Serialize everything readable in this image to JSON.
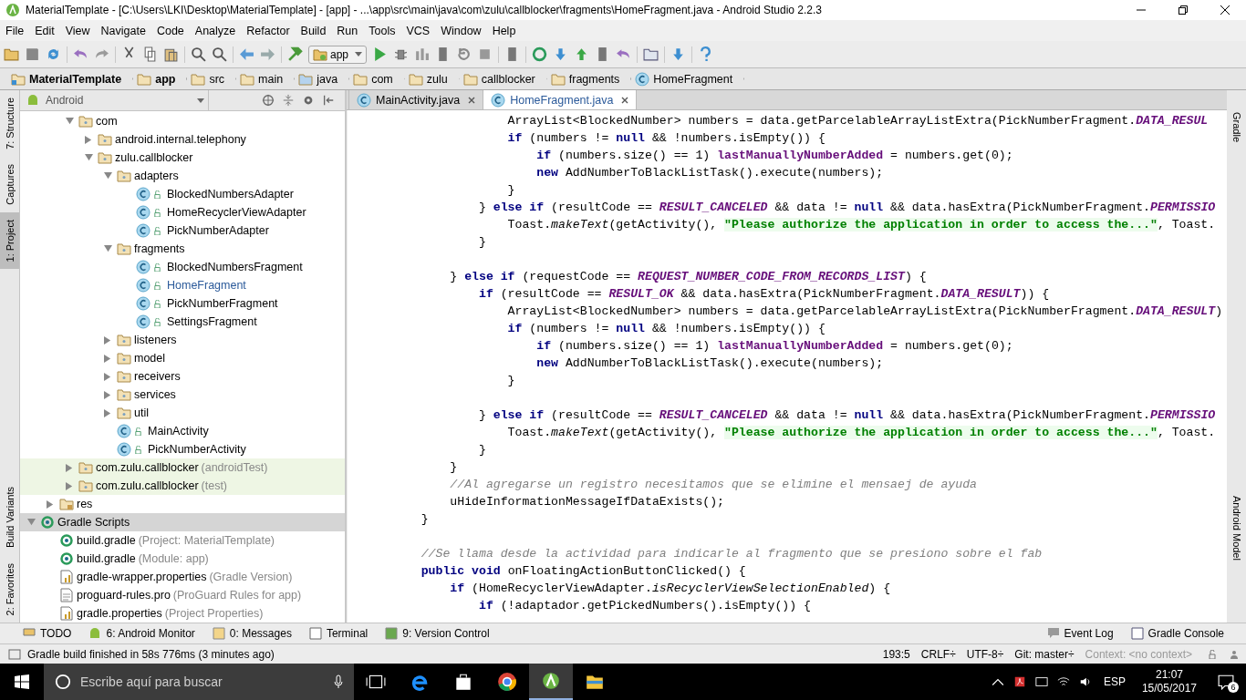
{
  "window": {
    "title": "MaterialTemplate - [C:\\Users\\LKI\\Desktop\\MaterialTemplate] - [app] - ...\\app\\src\\main\\java\\com\\zulu\\callblocker\\fragments\\HomeFragment.java - Android Studio 2.2.3"
  },
  "menu": [
    "File",
    "Edit",
    "View",
    "Navigate",
    "Code",
    "Analyze",
    "Refactor",
    "Build",
    "Run",
    "Tools",
    "VCS",
    "Window",
    "Help"
  ],
  "toolbar": {
    "run_config": "app"
  },
  "breadcrumbs": [
    {
      "kind": "project",
      "label": "MaterialTemplate"
    },
    {
      "kind": "module",
      "label": "app"
    },
    {
      "kind": "folder",
      "label": "src"
    },
    {
      "kind": "folder",
      "label": "main"
    },
    {
      "kind": "source",
      "label": "java"
    },
    {
      "kind": "folder",
      "label": "com"
    },
    {
      "kind": "folder",
      "label": "zulu"
    },
    {
      "kind": "folder",
      "label": "callblocker"
    },
    {
      "kind": "folder",
      "label": "fragments"
    },
    {
      "kind": "class",
      "label": "HomeFragment"
    }
  ],
  "left_stripe": [
    {
      "label": "7: Structure",
      "selected": false
    },
    {
      "label": "Captures",
      "selected": false
    },
    {
      "label": "1: Project",
      "selected": true
    },
    {
      "label": "Build Variants",
      "selected": false
    },
    {
      "label": "2: Favorites",
      "selected": false
    }
  ],
  "right_stripe": [
    {
      "label": "Gradle"
    },
    {
      "label": "Android Model"
    }
  ],
  "project_panel": {
    "view": "Android",
    "tree": [
      {
        "children": [
          {
            "children": [
              {
                "kind": "package",
                "label": "com",
                "expanded": true,
                "selected": false,
                "children": [
                  {
                    "kind": "package",
                    "label": "android.internal.telephony",
                    "expanded": false,
                    "selected": false
                  },
                  {
                    "kind": "package",
                    "label": "zulu.callblocker",
                    "expanded": true,
                    "selected": false,
                    "children": [
                      {
                        "kind": "package",
                        "label": "adapters",
                        "expanded": true,
                        "selected": false,
                        "children": [
                          {
                            "kind": "class",
                            "label": "BlockedNumbersAdapter",
                            "selected": false,
                            "open": false
                          },
                          {
                            "kind": "class",
                            "label": "HomeRecyclerViewAdapter",
                            "selected": false,
                            "open": false
                          },
                          {
                            "kind": "class",
                            "label": "PickNumberAdapter",
                            "selected": false,
                            "open": false
                          }
                        ]
                      },
                      {
                        "kind": "package",
                        "label": "fragments",
                        "expanded": true,
                        "selected": false,
                        "children": [
                          {
                            "kind": "class",
                            "label": "BlockedNumbersFragment",
                            "selected": false,
                            "open": false
                          },
                          {
                            "kind": "class",
                            "label": "HomeFragment",
                            "selected": false,
                            "open": true
                          },
                          {
                            "kind": "class",
                            "label": "PickNumberFragment",
                            "selected": false,
                            "open": false
                          },
                          {
                            "kind": "class",
                            "label": "SettingsFragment",
                            "selected": false,
                            "open": false
                          }
                        ]
                      },
                      {
                        "kind": "package",
                        "label": "listeners",
                        "expanded": false,
                        "selected": false
                      },
                      {
                        "kind": "package",
                        "label": "model",
                        "expanded": false,
                        "selected": false
                      },
                      {
                        "kind": "package",
                        "label": "receivers",
                        "expanded": false,
                        "selected": false
                      },
                      {
                        "kind": "package",
                        "label": "services",
                        "expanded": false,
                        "selected": false
                      },
                      {
                        "kind": "package",
                        "label": "util",
                        "expanded": false,
                        "selected": false
                      },
                      {
                        "kind": "class",
                        "label": "MainActivity",
                        "selected": false,
                        "open": false
                      },
                      {
                        "kind": "class",
                        "label": "PickNumberActivity",
                        "selected": false,
                        "open": false
                      }
                    ]
                  }
                ]
              },
              {
                "kind": "test-package",
                "label": "com.zulu.callblocker",
                "note": "(androidTest)",
                "expanded": false,
                "selected": false
              },
              {
                "kind": "test-package",
                "label": "com.zulu.callblocker",
                "note": "(test)",
                "expanded": false,
                "selected": false
              }
            ]
          },
          {
            "kind": "res",
            "label": "res",
            "expanded": false,
            "selected": false
          }
        ]
      },
      {
        "kind": "gradle-scripts",
        "label": "Gradle Scripts",
        "expanded": true,
        "selected": true,
        "children": [
          {
            "kind": "gradle",
            "label": "build.gradle",
            "note": "(Project: MaterialTemplate)",
            "selected": false
          },
          {
            "kind": "gradle",
            "label": "build.gradle",
            "note": "(Module: app)",
            "selected": false
          },
          {
            "kind": "properties",
            "label": "gradle-wrapper.properties",
            "note": "(Gradle Version)",
            "selected": false
          },
          {
            "kind": "file",
            "label": "proguard-rules.pro",
            "note": "(ProGuard Rules for app)",
            "selected": false
          },
          {
            "kind": "properties",
            "label": "gradle.properties",
            "note": "(Project Properties)",
            "selected": false
          }
        ]
      }
    ]
  },
  "editor_tabs": [
    {
      "label": "MainActivity.java",
      "selected": false
    },
    {
      "label": "HomeFragment.java",
      "selected": true
    }
  ],
  "code": [
    {
      "gap_before": false,
      "tokens": [
        {
          "kind": "plain",
          "text": "                ArrayList<BlockedNumber> numbers = data.getParcelableArrayListExtra(PickNumberFragment."
        },
        {
          "kind": "const",
          "text": "DATA_RESUL"
        }
      ]
    },
    {
      "gap_before": false,
      "tokens": [
        {
          "kind": "kw",
          "text": "                if"
        },
        {
          "kind": "plain",
          "text": " (numbers != "
        },
        {
          "kind": "kw",
          "text": "null"
        },
        {
          "kind": "plain",
          "text": " && !numbers.isEmpty()) {"
        }
      ]
    },
    {
      "gap_before": false,
      "tokens": [
        {
          "kind": "kw",
          "text": "                    if"
        },
        {
          "kind": "plain",
          "text": " (numbers.size() == 1) "
        },
        {
          "kind": "field",
          "text": "lastManuallyNumberAdded"
        },
        {
          "kind": "plain",
          "text": " = numbers.get(0);"
        }
      ]
    },
    {
      "gap_before": false,
      "tokens": [
        {
          "kind": "kw",
          "text": "                    new"
        },
        {
          "kind": "plain",
          "text": " AddNumberToBlackListTask().execute(numbers);"
        }
      ]
    },
    {
      "gap_before": false,
      "tokens": [
        {
          "kind": "plain",
          "text": "                }"
        }
      ]
    },
    {
      "gap_before": false,
      "tokens": [
        {
          "kind": "plain",
          "text": "            } "
        },
        {
          "kind": "kw",
          "text": "else if"
        },
        {
          "kind": "plain",
          "text": " (resultCode == "
        },
        {
          "kind": "const",
          "text": "RESULT_CANCELED"
        },
        {
          "kind": "plain",
          "text": " && data != "
        },
        {
          "kind": "kw",
          "text": "null"
        },
        {
          "kind": "plain",
          "text": " && data.hasExtra(PickNumberFragment."
        },
        {
          "kind": "const",
          "text": "PERMISSIO"
        }
      ]
    },
    {
      "gap_before": false,
      "tokens": [
        {
          "kind": "plain",
          "text": "                Toast."
        },
        {
          "kind": "static",
          "text": "makeText"
        },
        {
          "kind": "plain",
          "text": "(getActivity(), "
        },
        {
          "kind": "string",
          "text": "\"Please authorize the application in order to access the...\""
        },
        {
          "kind": "plain",
          "text": ", Toast."
        }
      ]
    },
    {
      "gap_before": false,
      "tokens": [
        {
          "kind": "plain",
          "text": "            }"
        }
      ]
    },
    {
      "gap_before": true,
      "tokens": [
        {
          "kind": "plain",
          "text": "        } "
        },
        {
          "kind": "kw",
          "text": "else if"
        },
        {
          "kind": "plain",
          "text": " (requestCode == "
        },
        {
          "kind": "const",
          "text": "REQUEST_NUMBER_CODE_FROM_RECORDS_LIST"
        },
        {
          "kind": "plain",
          "text": ") {"
        }
      ]
    },
    {
      "gap_before": false,
      "tokens": [
        {
          "kind": "kw",
          "text": "            if"
        },
        {
          "kind": "plain",
          "text": " (resultCode == "
        },
        {
          "kind": "const",
          "text": "RESULT_OK"
        },
        {
          "kind": "plain",
          "text": " && data.hasExtra(PickNumberFragment."
        },
        {
          "kind": "const",
          "text": "DATA_RESULT"
        },
        {
          "kind": "plain",
          "text": ")) {"
        }
      ]
    },
    {
      "gap_before": false,
      "tokens": [
        {
          "kind": "plain",
          "text": "                ArrayList<BlockedNumber> numbers = data.getParcelableArrayListExtra(PickNumberFragment."
        },
        {
          "kind": "const",
          "text": "DATA_RESULT"
        },
        {
          "kind": "plain",
          "text": ")"
        }
      ]
    },
    {
      "gap_before": false,
      "tokens": [
        {
          "kind": "kw",
          "text": "                if"
        },
        {
          "kind": "plain",
          "text": " (numbers != "
        },
        {
          "kind": "kw",
          "text": "null"
        },
        {
          "kind": "plain",
          "text": " && !numbers.isEmpty()) {"
        }
      ]
    },
    {
      "gap_before": false,
      "tokens": [
        {
          "kind": "kw",
          "text": "                    if"
        },
        {
          "kind": "plain",
          "text": " (numbers.size() == 1) "
        },
        {
          "kind": "field",
          "text": "lastManuallyNumberAdded"
        },
        {
          "kind": "plain",
          "text": " = numbers.get(0);"
        }
      ]
    },
    {
      "gap_before": false,
      "tokens": [
        {
          "kind": "kw",
          "text": "                    new"
        },
        {
          "kind": "plain",
          "text": " AddNumberToBlackListTask().execute(numbers);"
        }
      ]
    },
    {
      "gap_before": false,
      "tokens": [
        {
          "kind": "plain",
          "text": "                }"
        }
      ]
    },
    {
      "gap_before": true,
      "tokens": [
        {
          "kind": "plain",
          "text": "            } "
        },
        {
          "kind": "kw",
          "text": "else if"
        },
        {
          "kind": "plain",
          "text": " (resultCode == "
        },
        {
          "kind": "const",
          "text": "RESULT_CANCELED"
        },
        {
          "kind": "plain",
          "text": " && data != "
        },
        {
          "kind": "kw",
          "text": "null"
        },
        {
          "kind": "plain",
          "text": " && data.hasExtra(PickNumberFragment."
        },
        {
          "kind": "const",
          "text": "PERMISSIO"
        }
      ]
    },
    {
      "gap_before": false,
      "tokens": [
        {
          "kind": "plain",
          "text": "                Toast."
        },
        {
          "kind": "static",
          "text": "makeText"
        },
        {
          "kind": "plain",
          "text": "(getActivity(), "
        },
        {
          "kind": "string",
          "text": "\"Please authorize the application in order to access the...\""
        },
        {
          "kind": "plain",
          "text": ", Toast."
        }
      ]
    },
    {
      "gap_before": false,
      "tokens": [
        {
          "kind": "plain",
          "text": "            }"
        }
      ]
    },
    {
      "gap_before": false,
      "tokens": [
        {
          "kind": "plain",
          "text": "        }"
        }
      ]
    },
    {
      "gap_before": false,
      "tokens": [
        {
          "kind": "comment",
          "text": "        //Al agregarse un registro necesitamos que se elimine el mensaej de ayuda"
        }
      ]
    },
    {
      "gap_before": false,
      "tokens": [
        {
          "kind": "plain",
          "text": "        uHideInformationMessageIfDataExists();"
        }
      ]
    },
    {
      "gap_before": false,
      "tokens": [
        {
          "kind": "plain",
          "text": "    }"
        }
      ]
    },
    {
      "gap_before": true,
      "tokens": [
        {
          "kind": "comment",
          "text": "    //Se llama desde la actividad para indicarle al fragmento que se presiono sobre el fab"
        }
      ]
    },
    {
      "gap_before": false,
      "tokens": [
        {
          "kind": "kw",
          "text": "    public void"
        },
        {
          "kind": "plain",
          "text": " onFloatingActionButtonClicked() {"
        }
      ]
    },
    {
      "gap_before": false,
      "tokens": [
        {
          "kind": "kw",
          "text": "        if"
        },
        {
          "kind": "plain",
          "text": " (HomeRecyclerViewAdapter."
        },
        {
          "kind": "static",
          "text": "isRecyclerViewSelectionEnabled"
        },
        {
          "kind": "plain",
          "text": ") {"
        }
      ]
    },
    {
      "gap_before": false,
      "tokens": [
        {
          "kind": "kw",
          "text": "            if"
        },
        {
          "kind": "plain",
          "text": " (!adaptador.getPickedNumbers().isEmpty()) {"
        }
      ]
    }
  ],
  "bottom_tools": [
    {
      "kind": "todo",
      "label": "TODO"
    },
    {
      "kind": "android",
      "label": "6: Android Monitor"
    },
    {
      "kind": "messages",
      "label": "0: Messages"
    },
    {
      "kind": "terminal",
      "label": "Terminal"
    },
    {
      "kind": "vcs",
      "label": "9: Version Control"
    }
  ],
  "bottom_tools_right": [
    {
      "kind": "log",
      "label": "Event Log"
    },
    {
      "kind": "console",
      "label": "Gradle Console"
    }
  ],
  "status_bar": {
    "message": "Gradle build finished in 58s 776ms (3 minutes ago)",
    "position": "193:5",
    "line_separator": "CRLF÷",
    "encoding": "UTF-8÷",
    "git": "Git: master÷",
    "context": "Context: <no context>"
  },
  "taskbar": {
    "search_placeholder": "Escribe aquí para buscar",
    "language": "ESP",
    "time": "21:07",
    "date": "15/05/2017",
    "notifications": "6"
  }
}
